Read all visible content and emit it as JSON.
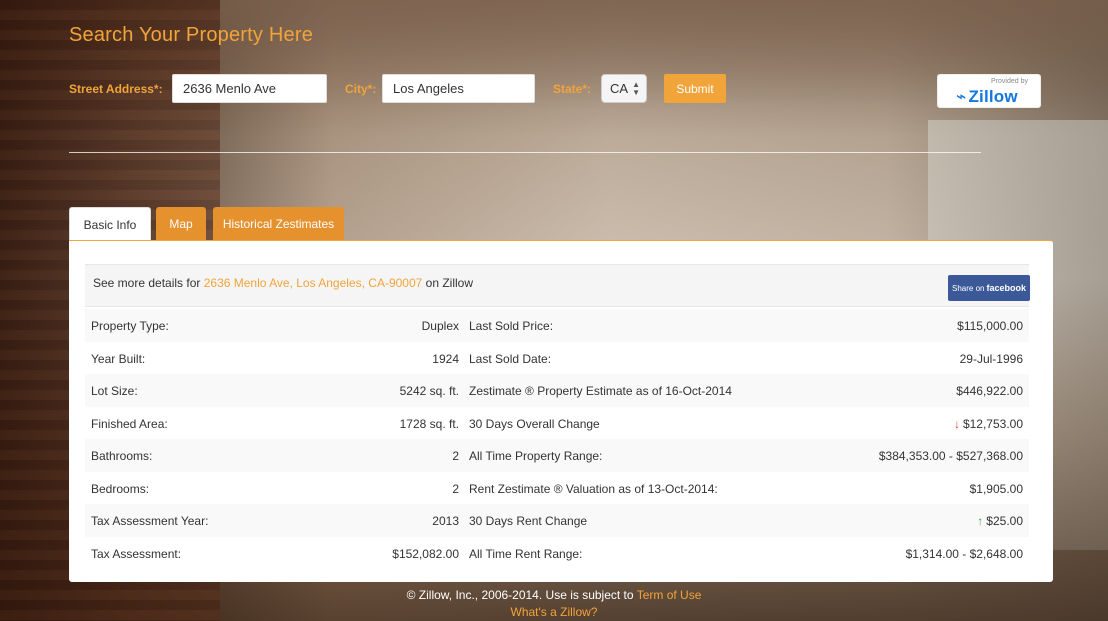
{
  "header": {
    "title": "Search Your Property Here"
  },
  "form": {
    "street_label": "Street Address*:",
    "street_value": "2636 Menlo Ave",
    "city_label": "City*:",
    "city_value": "Los Angeles",
    "state_label": "State*:",
    "state_value": "CA",
    "submit_label": "Submit"
  },
  "badge": {
    "provided_by": "Provided by",
    "brand": "Zillow"
  },
  "tabs": [
    {
      "label": "Basic Info",
      "active": true
    },
    {
      "label": "Map",
      "active": false
    },
    {
      "label": "Historical Zestimates",
      "active": false
    }
  ],
  "details": {
    "prefix": "See more details for ",
    "link": "2636 Menlo Ave, Los Angeles, CA-90007",
    "suffix": " on Zillow",
    "share_label": "Share on",
    "share_brand": "facebook"
  },
  "rows": [
    {
      "label": "Property Type:",
      "value": "Duplex",
      "label2": "Last Sold Price:",
      "value2": "$115,000.00"
    },
    {
      "label": "Year Built:",
      "value": "1924",
      "label2": "Last Sold Date:",
      "value2": "29-Jul-1996"
    },
    {
      "label": "Lot Size:",
      "value": "5242 sq. ft.",
      "label2": "Zestimate ® Property Estimate as of 16-Oct-2014",
      "value2": "$446,922.00"
    },
    {
      "label": "Finished Area:",
      "value": "1728 sq. ft.",
      "label2": "30 Days Overall Change",
      "value2": "$12,753.00",
      "trend": "down"
    },
    {
      "label": "Bathrooms:",
      "value": "2",
      "label2": "All Time Property Range:",
      "value2": "$384,353.00 - $527,368.00"
    },
    {
      "label": "Bedrooms:",
      "value": "2",
      "label2": "Rent Zestimate ® Valuation as of 13-Oct-2014:",
      "value2": "$1,905.00"
    },
    {
      "label": "Tax Assessment Year:",
      "value": "2013",
      "label2": "30 Days Rent Change",
      "value2": "$25.00",
      "trend": "up"
    },
    {
      "label": "Tax Assessment:",
      "value": "$152,082.00",
      "label2": "All Time Rent Range:",
      "value2": "$1,314.00 - $2,648.00"
    }
  ],
  "footer": {
    "text": "© Zillow, Inc., 2006-2014. Use is subject to ",
    "terms_link": "Term of Use",
    "what_link": "What's a Zillow?"
  },
  "colors": {
    "accent": "#f0a43a",
    "tab_inactive": "#e4912e",
    "facebook": "#3b5998",
    "zillow": "#1277e1",
    "down": "#e53b2c",
    "up": "#3aa64b"
  }
}
